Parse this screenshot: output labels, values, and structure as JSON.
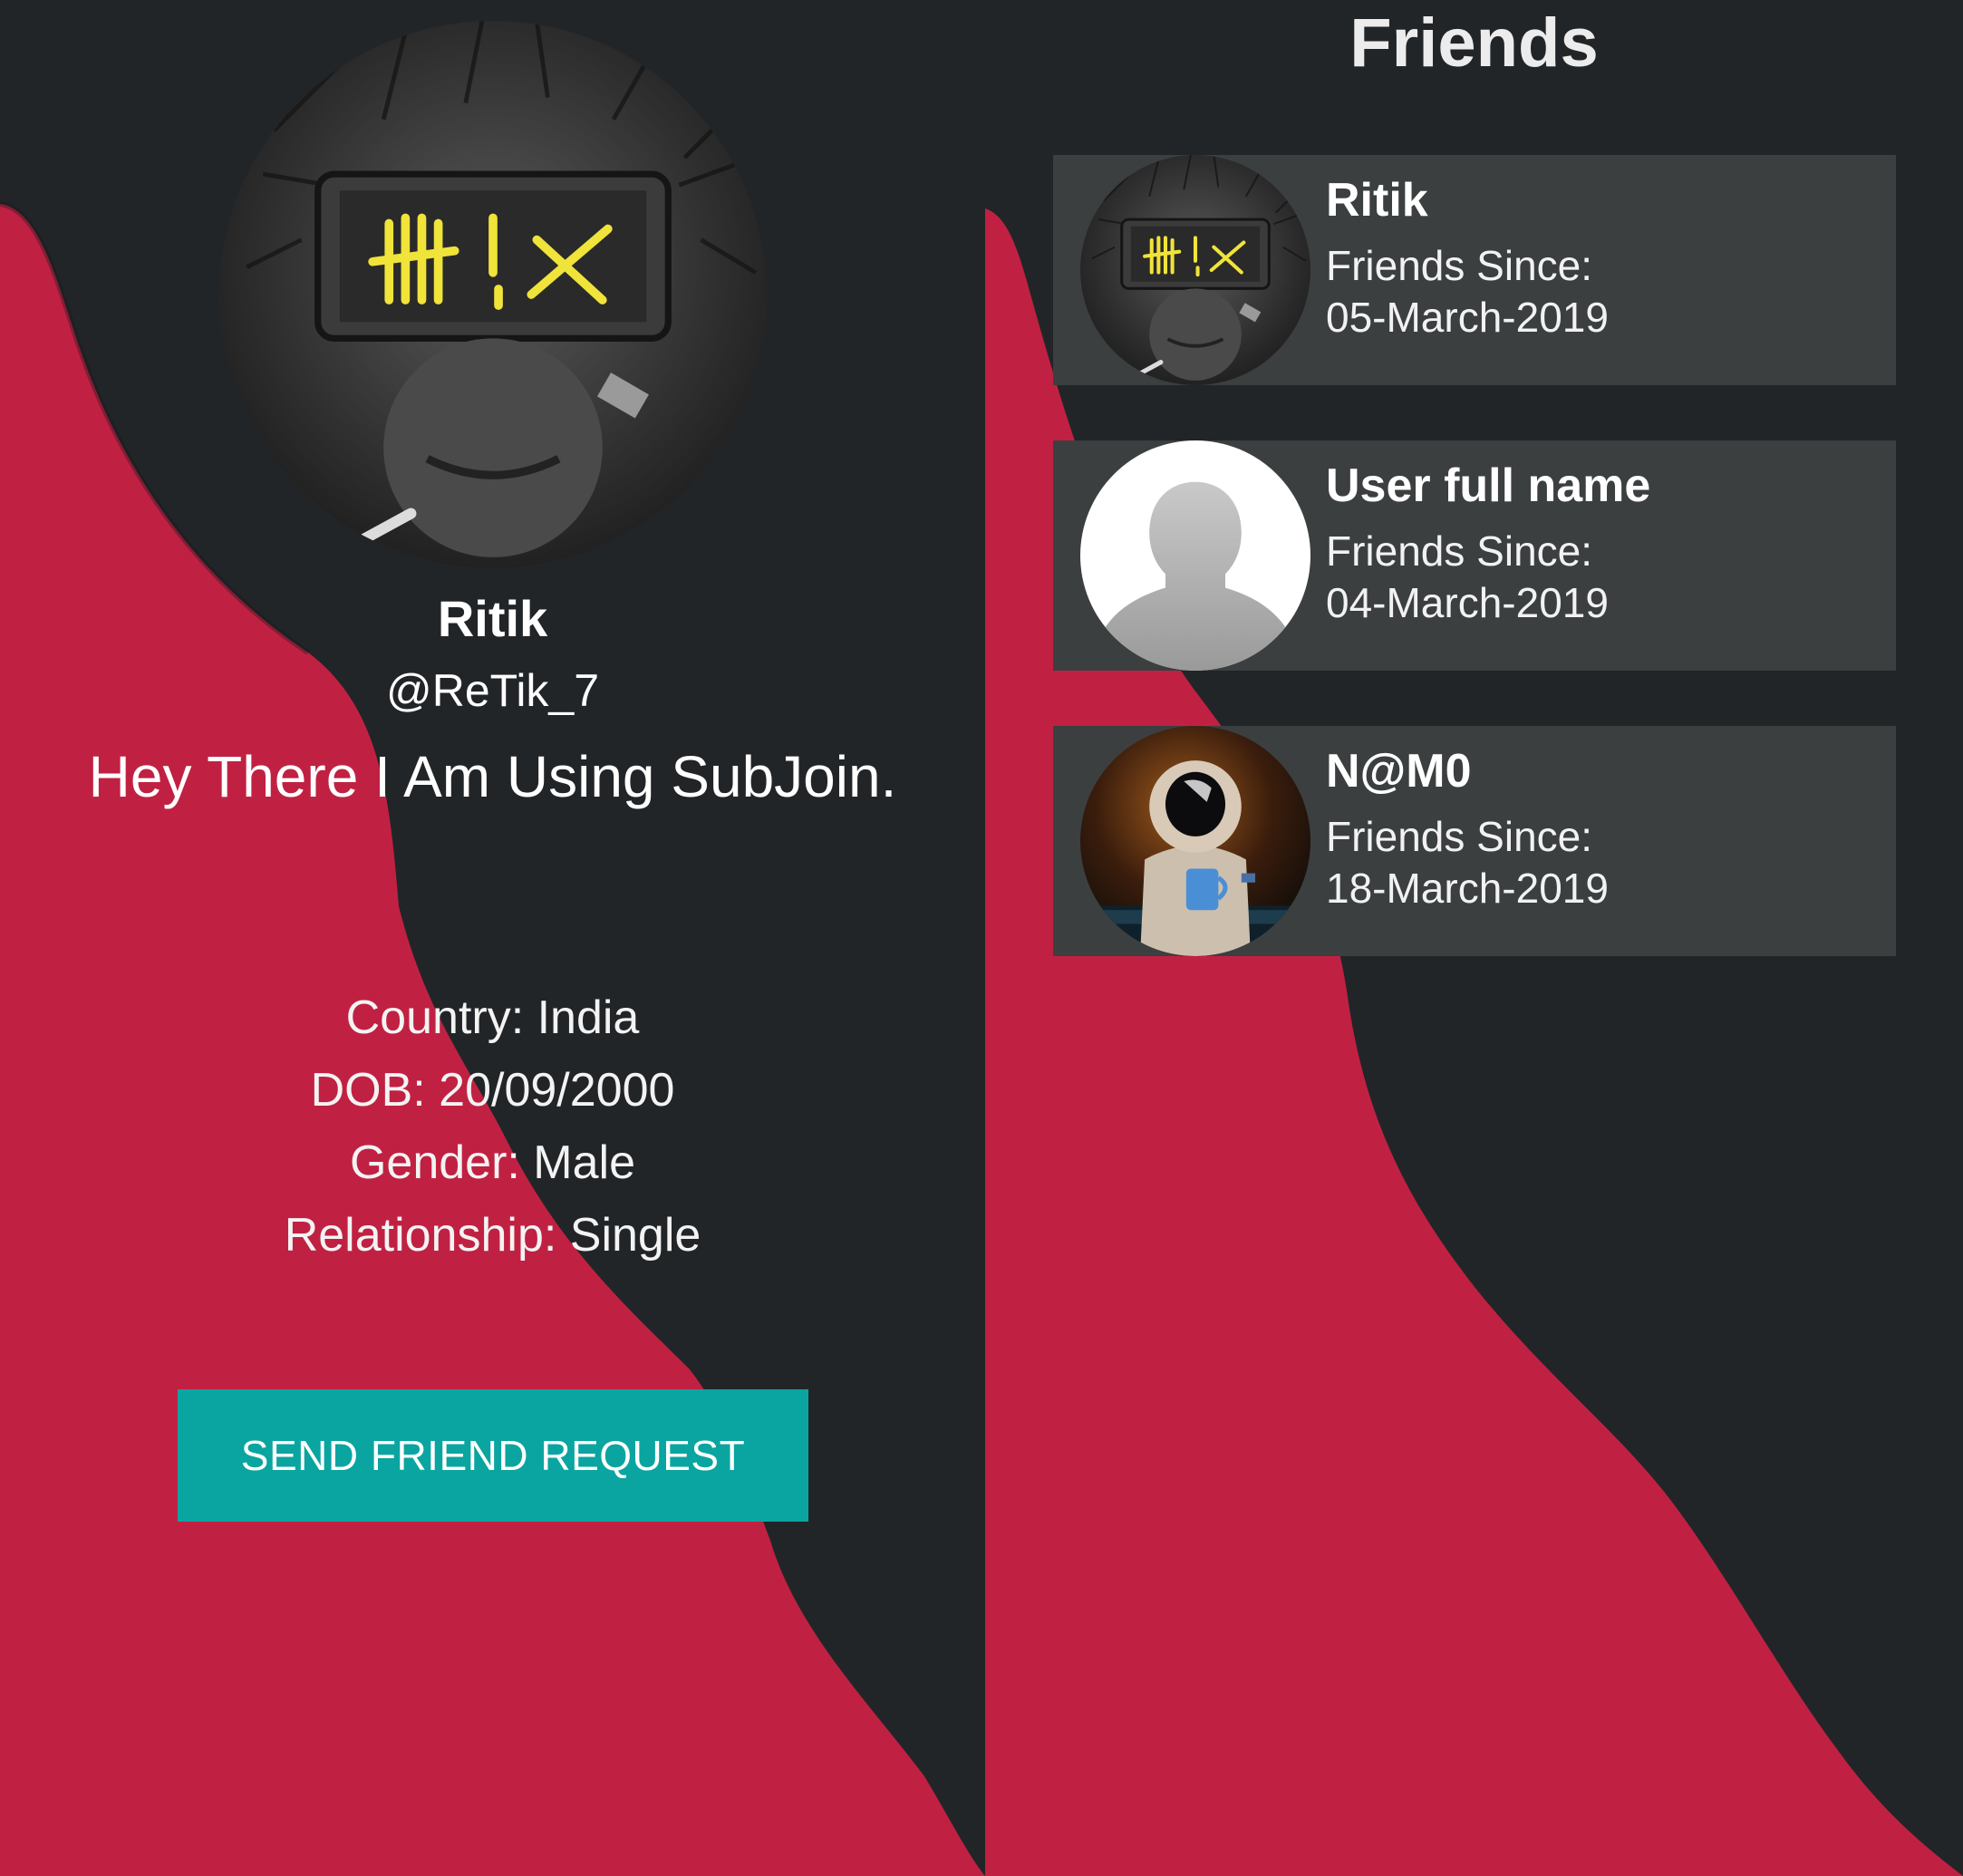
{
  "colors": {
    "background_dark": "#222528",
    "wave_red": "#c02142",
    "card_bg": "#3b3f40",
    "accent_teal": "#0aa5a0",
    "text_white": "#ffffff"
  },
  "profile": {
    "avatar_icon": "cyberpunk-avatar-image",
    "name": "Ritik",
    "username": "@ReTik_7",
    "status": "Hey There I Am Using SubJoin.",
    "country": "Country: India",
    "dob": "DOB: 20/09/2000",
    "gender": "Gender: Male",
    "relationship": "Relationship: Single",
    "send_request_label": "SEND FRIEND REQUEST"
  },
  "friends": {
    "title": "Friends",
    "items": [
      {
        "name": "Ritik",
        "since_label": "Friends Since:",
        "since_date": "05-March-2019",
        "avatar": "cyberpunk-avatar-image"
      },
      {
        "name": "User full name",
        "since_label": "Friends Since:",
        "since_date": "04-March-2019",
        "avatar": "default-user-silhouette-icon"
      },
      {
        "name": "N@M0",
        "since_label": "Friends Since:",
        "since_date": "18-March-2019",
        "avatar": "astronaut-avatar-image"
      }
    ]
  }
}
